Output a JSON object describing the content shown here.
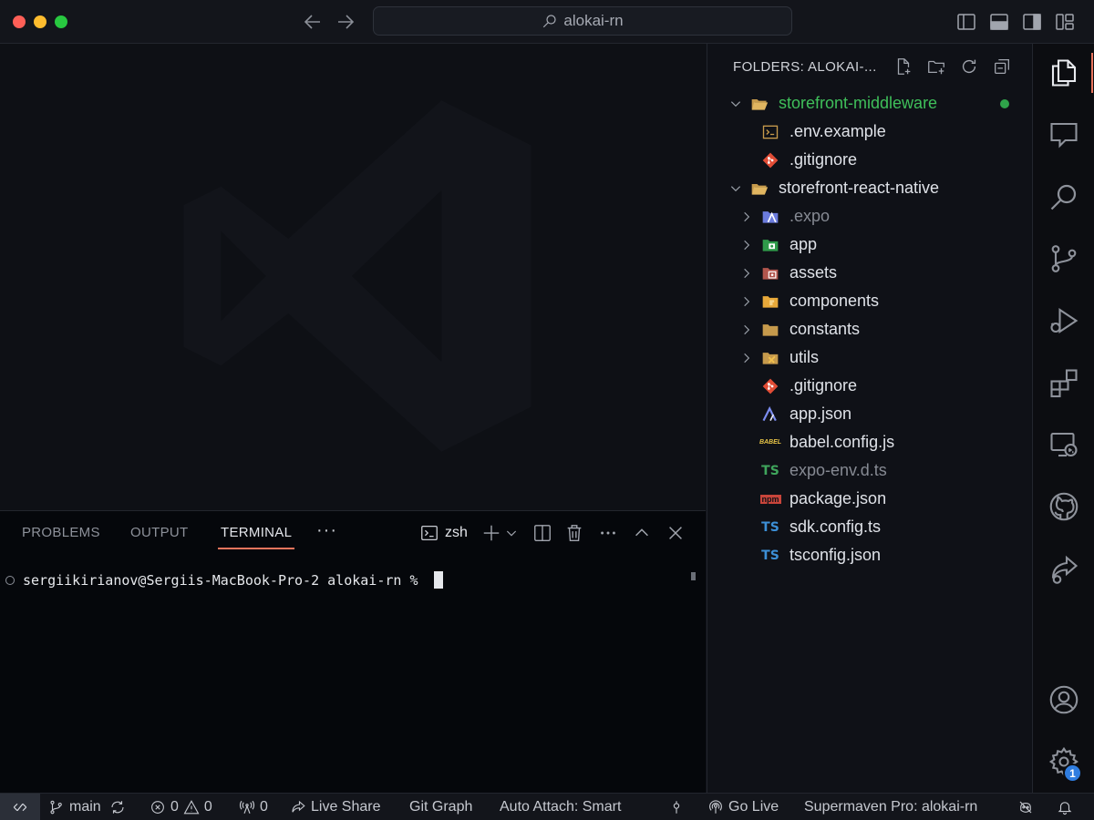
{
  "window": {
    "command_center_text": "alokai-rn"
  },
  "panel": {
    "tabs": [
      "PROBLEMS",
      "OUTPUT",
      "TERMINAL"
    ],
    "active_tab": "TERMINAL",
    "more_label": "···",
    "terminal_shell": "zsh",
    "terminal_prompt": "sergiikirianov@Sergiis-MacBook-Pro-2 alokai-rn % "
  },
  "explorer": {
    "title": "FOLDERS: ALOKAI-...",
    "items": [
      {
        "label": "storefront-middleware",
        "type": "folder-root",
        "icon": "folder-open-icon"
      },
      {
        "label": ".env.example",
        "type": "file",
        "icon": "terminal-file-icon"
      },
      {
        "label": ".gitignore",
        "type": "file",
        "icon": "git-icon"
      },
      {
        "label": "storefront-react-native",
        "type": "folder-root",
        "icon": "folder-open-icon"
      },
      {
        "label": ".expo",
        "type": "folder",
        "icon": "expo-folder-icon"
      },
      {
        "label": "app",
        "type": "folder",
        "icon": "app-folder-icon"
      },
      {
        "label": "assets",
        "type": "folder",
        "icon": "assets-folder-icon"
      },
      {
        "label": "components",
        "type": "folder",
        "icon": "components-folder-icon"
      },
      {
        "label": "constants",
        "type": "folder",
        "icon": "folder-icon"
      },
      {
        "label": "utils",
        "type": "folder",
        "icon": "utils-folder-icon"
      },
      {
        "label": ".gitignore",
        "type": "file",
        "icon": "git-icon"
      },
      {
        "label": "app.json",
        "type": "file",
        "icon": "expo-file-icon"
      },
      {
        "label": "babel.config.js",
        "type": "file",
        "icon": "babel-icon"
      },
      {
        "label": "expo-env.d.ts",
        "type": "file",
        "icon": "ts-def-icon"
      },
      {
        "label": "package.json",
        "type": "file",
        "icon": "npm-icon"
      },
      {
        "label": "sdk.config.ts",
        "type": "file",
        "icon": "ts-icon"
      },
      {
        "label": "tsconfig.json",
        "type": "file",
        "icon": "tsconfig-icon"
      }
    ]
  },
  "icons": {
    "ts_text": "TS",
    "babel_text": "BABEL",
    "npm_text": "npm"
  },
  "activity": {
    "settings_badge": "1"
  },
  "statusbar": {
    "branch": "main",
    "errors": "0",
    "warnings": "0",
    "ports": "0",
    "live_share": "Live Share",
    "git_graph": "Git Graph",
    "auto_attach": "Auto Attach: Smart",
    "go_live": "Go Live",
    "supermaven": "Supermaven Pro: alokai-rn"
  },
  "colors": {
    "accent": "#e8745c",
    "modified_green": "#3fbf5a",
    "badge_blue": "#2f7de0"
  }
}
